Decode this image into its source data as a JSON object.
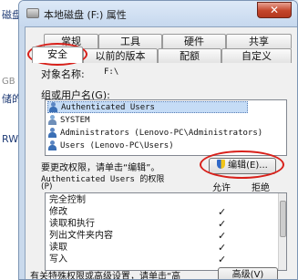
{
  "background": {
    "fragments": [
      "磁盘",
      "GB 可",
      "储的",
      "RW 驱"
    ]
  },
  "window": {
    "title": "本地磁盘 (F:) 属性",
    "close_glyph": "✕"
  },
  "tabs": {
    "row1": [
      "常规",
      "工具",
      "硬件",
      "共享"
    ],
    "row2": [
      "安全",
      "以前的版本",
      "配额",
      "自定义"
    ],
    "active": "安全"
  },
  "security": {
    "object_name_label": "对象名称:",
    "object_name_value": "F:\\",
    "groups_label": "组或用户名(G):",
    "users": [
      "Authenticated Users",
      "SYSTEM",
      "Administrators (Lenovo-PC\\Administrators)",
      "Users (Lenovo-PC\\Users)"
    ],
    "selected_user_index": 0,
    "change_hint": "要更改权限，请单击“编辑”。",
    "edit_button": "编辑(E)...",
    "permissions_header": "Authenticated Users 的权限",
    "permissions_header_suffix": "(P)",
    "allow_label": "允许",
    "deny_label": "拒绝",
    "permissions": [
      {
        "name": "完全控制",
        "allow": false
      },
      {
        "name": "修改",
        "allow": true
      },
      {
        "name": "读取和执行",
        "allow": true
      },
      {
        "name": "列出文件夹内容",
        "allow": true
      },
      {
        "name": "读取",
        "allow": true
      },
      {
        "name": "写入",
        "allow": true
      }
    ],
    "check_glyph": "✓",
    "footer_text": "有关特殊权限或高级设置，请单击“高",
    "advanced_button": "高级(V)"
  }
}
